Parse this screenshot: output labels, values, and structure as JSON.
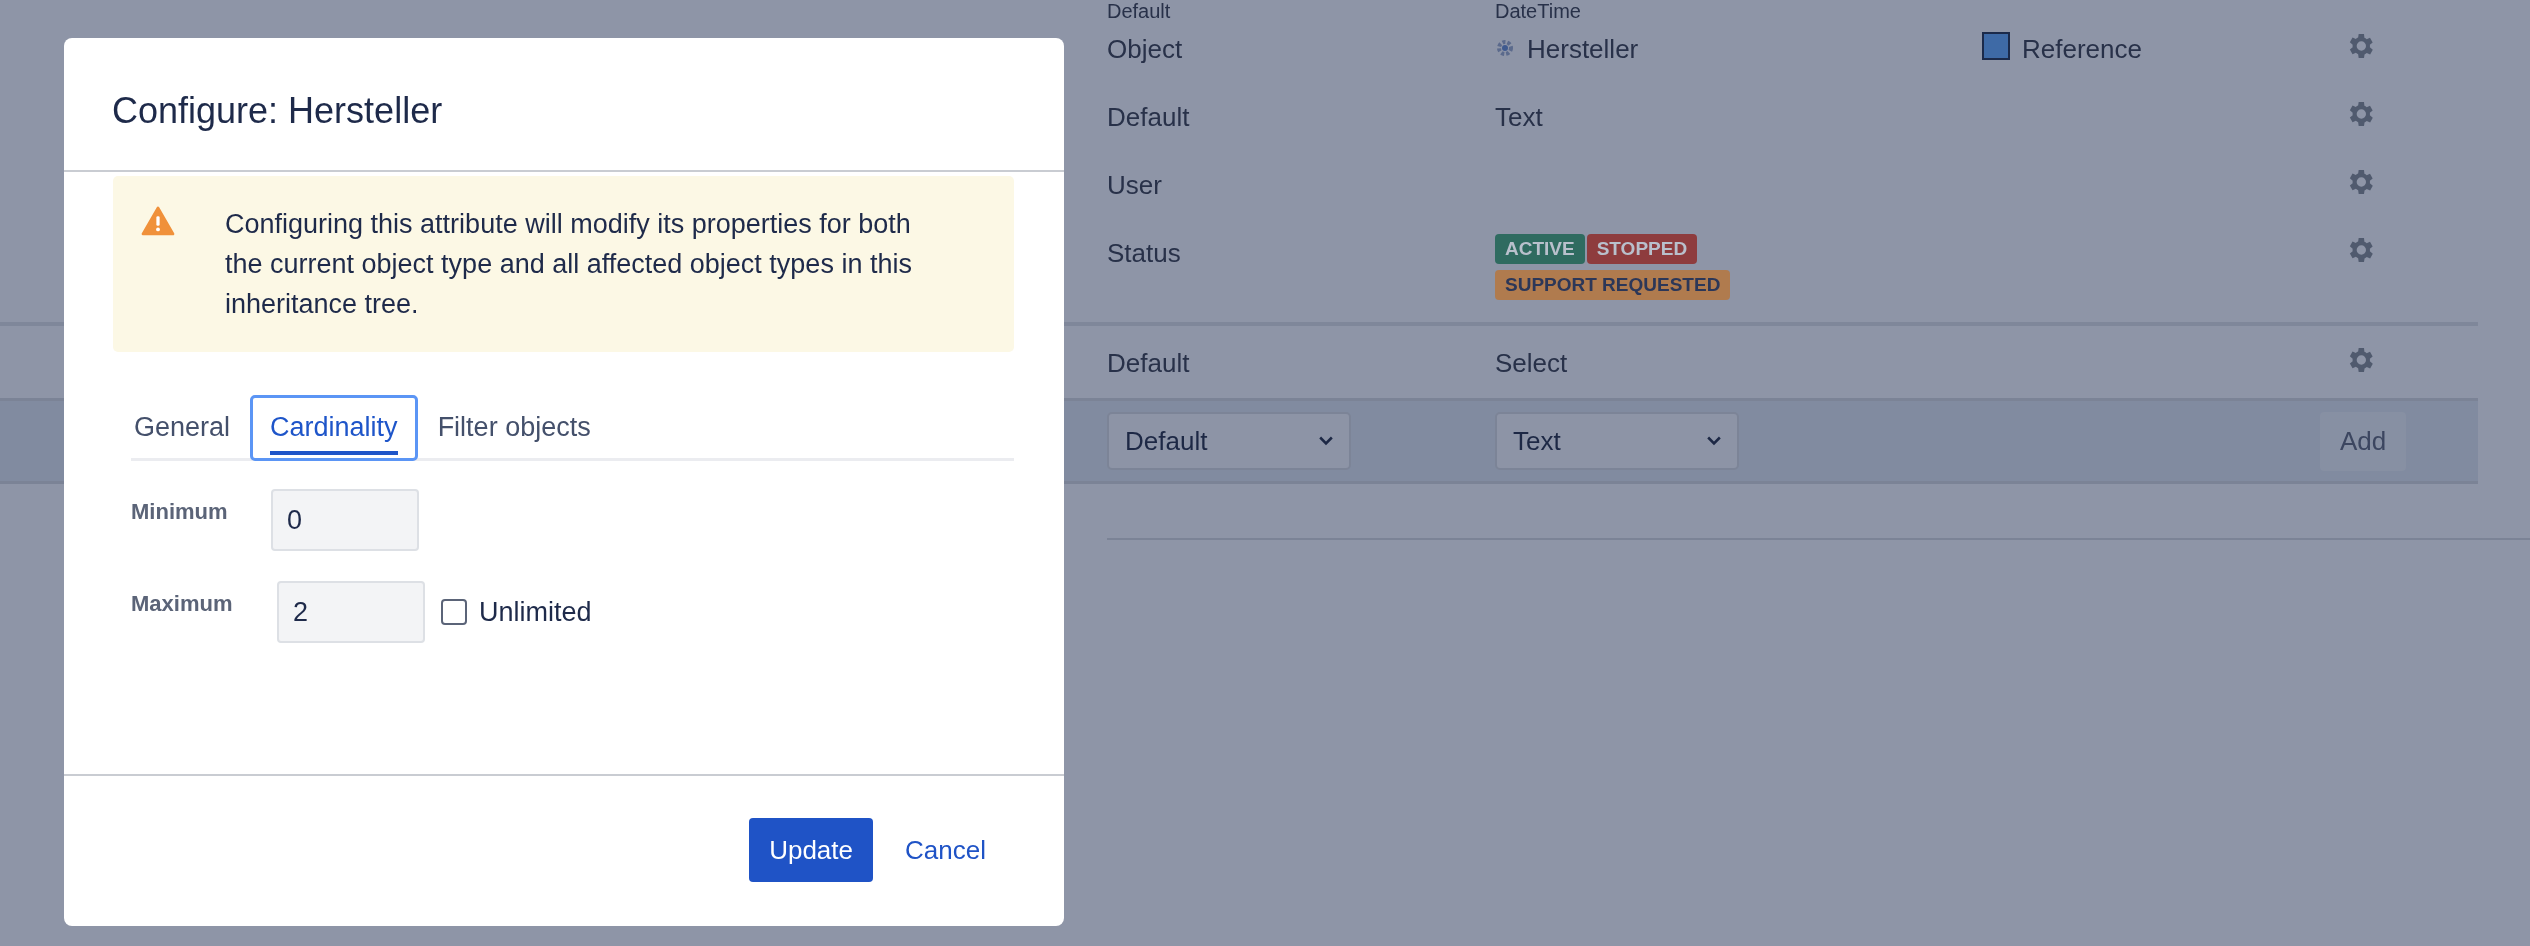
{
  "background": {
    "rows": [
      {
        "kind": "text",
        "type": "Default",
        "value": "DateTime"
      },
      {
        "kind": "object",
        "type": "Object",
        "value": "Hersteller",
        "reference": "Reference"
      },
      {
        "kind": "text",
        "type": "Default",
        "value": "Text"
      },
      {
        "kind": "text",
        "type": "User",
        "value": ""
      },
      {
        "kind": "badges",
        "type": "Status",
        "badges": [
          {
            "label": "ACTIVE",
            "color": "#2f6b60"
          },
          {
            "label": "STOPPED",
            "color": "#8e3c3e"
          },
          {
            "label": "SUPPORT REQUESTED",
            "color": "#b07b4e"
          }
        ]
      },
      {
        "kind": "text",
        "type": "Default",
        "value": "Select"
      }
    ],
    "add_row": {
      "type_select": "Default",
      "value_select": "Text",
      "add_button": "Add"
    }
  },
  "dialog": {
    "title": "Configure: Hersteller",
    "warning": "Configuring this attribute will modify its properties for both the current object type and all affected object types in this inheritance tree.",
    "tabs": [
      {
        "label": "General",
        "selected": false
      },
      {
        "label": "Cardinality",
        "selected": true
      },
      {
        "label": "Filter objects",
        "selected": false
      }
    ],
    "fields": [
      {
        "label": "Minimum",
        "value": "0"
      },
      {
        "label": "Maximum",
        "value": "2",
        "checkbox": {
          "label": "Unlimited",
          "checked": false
        }
      }
    ],
    "buttons": {
      "primary": "Update",
      "cancel": "Cancel"
    }
  }
}
